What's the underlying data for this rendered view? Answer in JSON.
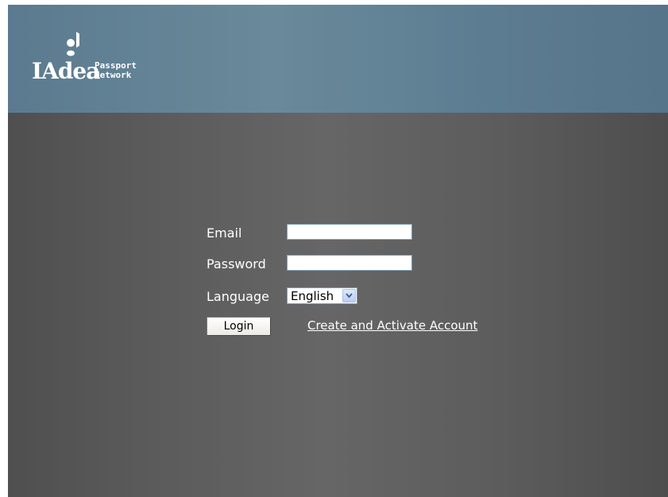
{
  "header": {
    "logo": {
      "wordmark": "IAdea",
      "subtitle_line1": "Passport",
      "subtitle_line2": "Network"
    }
  },
  "form": {
    "email_label": "Email",
    "email_value": "",
    "password_label": "Password",
    "password_value": "",
    "language_label": "Language",
    "language_selected": "English",
    "login_label": "Login",
    "create_link_label": "Create and Activate Account"
  },
  "colors": {
    "header_bg": "#6a8a9b",
    "main_bg": "#5a5a5a",
    "text": "#ffffff"
  },
  "icons": {
    "logo": "iadea-logo-icon",
    "dropdown": "chevron-down-icon"
  }
}
